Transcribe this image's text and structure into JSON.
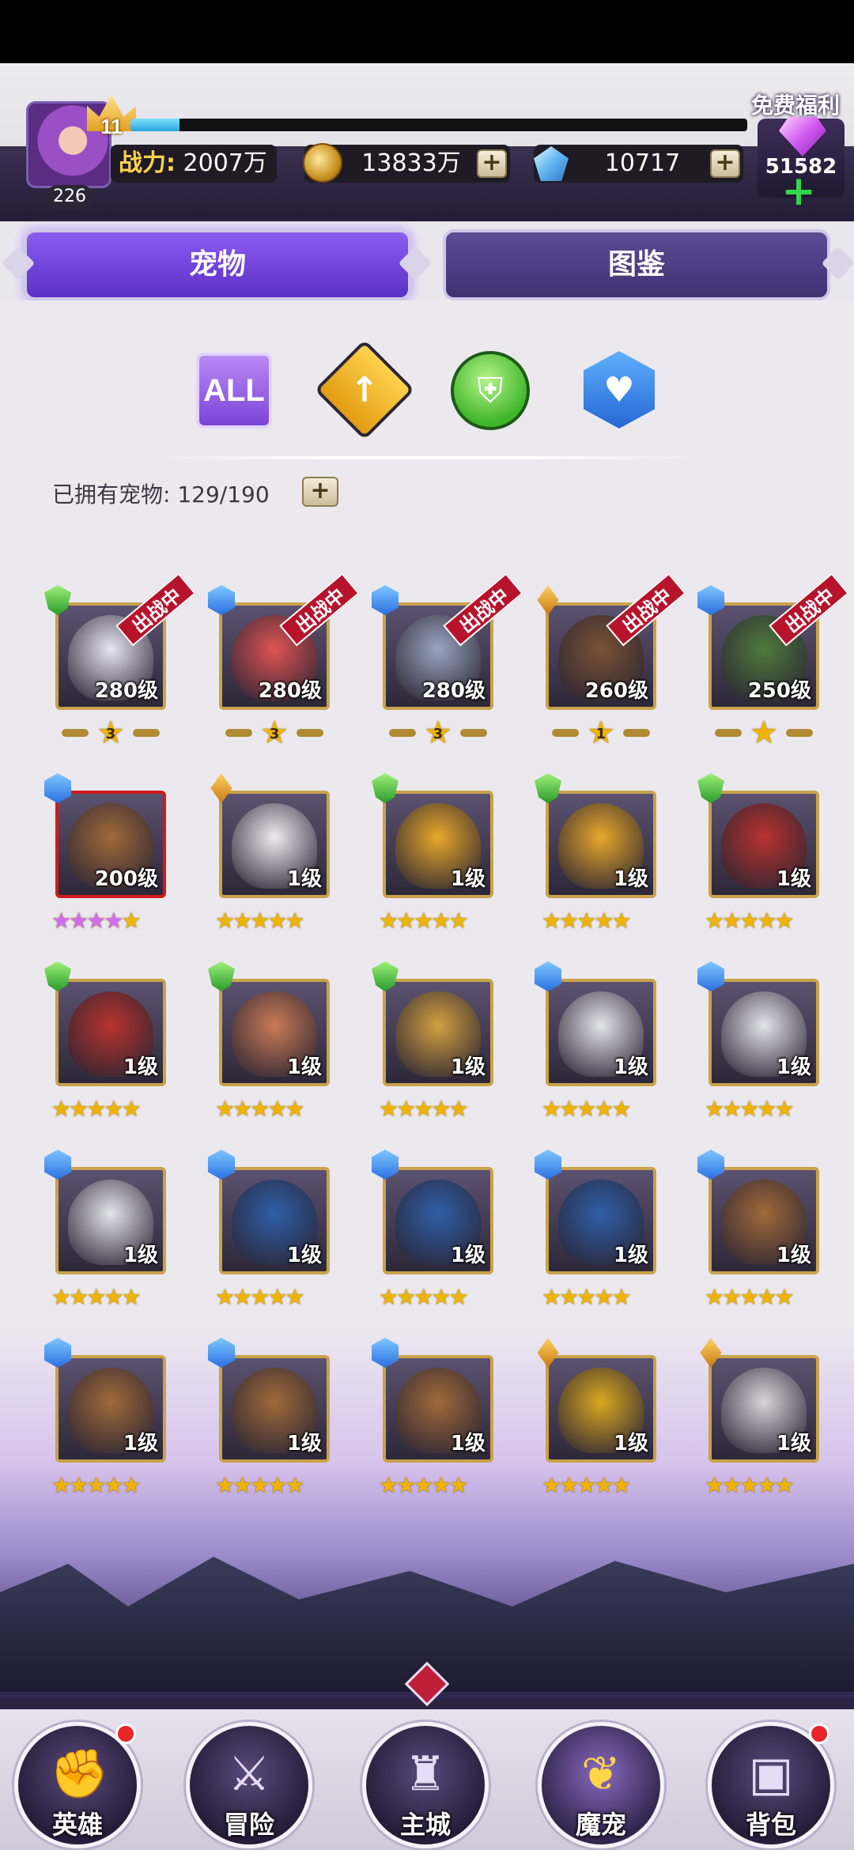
{
  "header": {
    "avatar_level": "11",
    "avatar_number": "226",
    "exp_progress": 0.08,
    "power_label": "战力:",
    "power_value": "2007万",
    "gold_value": "13833万",
    "gems_value": "10717",
    "free_label": "免费福利",
    "free_value": "51582",
    "plus": "+"
  },
  "tabs": [
    {
      "label": "宠物",
      "active": true
    },
    {
      "label": "图鉴",
      "active": false
    }
  ],
  "filters": {
    "all_label": "ALL",
    "attack_icon": "sword-icon",
    "defense_icon": "shield-icon",
    "support_icon": "heart-icon"
  },
  "owned": {
    "text": "已拥有宠物: 129/190"
  },
  "deploy_tag": "出战中",
  "pets": [
    {
      "level": "280级",
      "type": "green",
      "deployed": true,
      "rank": "3",
      "color": "#e8e6f2"
    },
    {
      "level": "280级",
      "type": "blue",
      "deployed": true,
      "rank": "3",
      "color": "#e05454"
    },
    {
      "level": "280级",
      "type": "blue",
      "deployed": true,
      "rank": "3",
      "color": "#9aa6c0"
    },
    {
      "level": "260级",
      "type": "orange",
      "deployed": true,
      "rank": "1",
      "color": "#7a5234"
    },
    {
      "level": "250级",
      "type": "blue",
      "deployed": true,
      "rank": "",
      "color": "#4f7a3c"
    },
    {
      "level": "200级",
      "type": "blue",
      "stars": 4,
      "stars_color": "pink",
      "color": "#a06a3a",
      "red": true
    },
    {
      "level": "1级",
      "type": "orange",
      "stars": 5,
      "color": "#efeaf2"
    },
    {
      "level": "1级",
      "type": "green",
      "stars": 5,
      "color": "#e8a82a"
    },
    {
      "level": "1级",
      "type": "green",
      "stars": 5,
      "color": "#e8a82a"
    },
    {
      "level": "1级",
      "type": "green",
      "stars": 5,
      "color": "#b8332e"
    },
    {
      "level": "1级",
      "type": "green",
      "stars": 5,
      "color": "#b8332e"
    },
    {
      "level": "1级",
      "type": "green",
      "stars": 5,
      "color": "#c97a56"
    },
    {
      "level": "1级",
      "type": "green",
      "stars": 5,
      "color": "#d2a040"
    },
    {
      "level": "1级",
      "type": "blue",
      "stars": 5,
      "color": "#e4e4ec"
    },
    {
      "level": "1级",
      "type": "blue",
      "stars": 5,
      "color": "#e4e4ec"
    },
    {
      "level": "1级",
      "type": "blue",
      "stars": 5,
      "color": "#e4e4ec"
    },
    {
      "level": "1级",
      "type": "blue",
      "stars": 5,
      "color": "#2f5fa8"
    },
    {
      "level": "1级",
      "type": "blue",
      "stars": 5,
      "color": "#2f5fa8"
    },
    {
      "level": "1级",
      "type": "blue",
      "stars": 5,
      "color": "#2f5fa8"
    },
    {
      "level": "1级",
      "type": "blue",
      "stars": 5,
      "color": "#a06a3a"
    },
    {
      "level": "1级",
      "type": "blue",
      "stars": 5,
      "color": "#a06a3a"
    },
    {
      "level": "1级",
      "type": "blue",
      "stars": 5,
      "color": "#a06a3a"
    },
    {
      "level": "1级",
      "type": "blue",
      "stars": 5,
      "color": "#a06a3a"
    },
    {
      "level": "1级",
      "type": "orange",
      "stars": 5,
      "color": "#d9a820"
    },
    {
      "level": "1级",
      "type": "orange",
      "stars": 5,
      "color": "#d8d4dc"
    }
  ],
  "nav": [
    {
      "label": "英雄",
      "icon": "fist-icon",
      "badge": true,
      "active": false
    },
    {
      "label": "冒险",
      "icon": "helmet-icon",
      "badge": false,
      "active": false
    },
    {
      "label": "主城",
      "icon": "castle-icon",
      "badge": false,
      "active": false
    },
    {
      "label": "魔宠",
      "icon": "dragon-icon",
      "badge": false,
      "active": true
    },
    {
      "label": "背包",
      "icon": "backpack-icon",
      "badge": true,
      "active": false
    }
  ]
}
